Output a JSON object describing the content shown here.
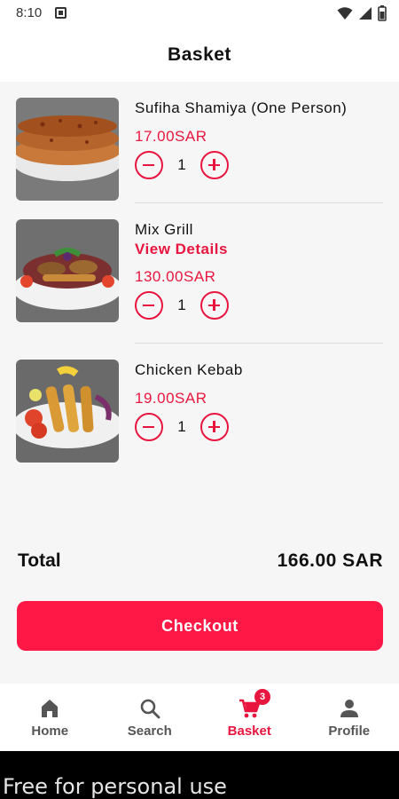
{
  "status_bar": {
    "time": "8:10"
  },
  "header": {
    "title": "Basket"
  },
  "items": [
    {
      "name": "Sufiha Shamiya (One Person)",
      "link": "",
      "price": "17.00SAR",
      "qty": "1"
    },
    {
      "name": "Mix Grill",
      "link": "View Details",
      "price": "130.00SAR",
      "qty": "1"
    },
    {
      "name": "Chicken Kebab",
      "link": "",
      "price": "19.00SAR",
      "qty": "1"
    }
  ],
  "summary": {
    "total_label": "Total",
    "total_value": "166.00 SAR"
  },
  "checkout": {
    "label": "Checkout"
  },
  "nav": {
    "items": [
      {
        "label": "Home",
        "icon": "home-icon"
      },
      {
        "label": "Search",
        "icon": "search-icon"
      },
      {
        "label": "Basket",
        "icon": "cart-icon",
        "badge": "3",
        "active": true
      },
      {
        "label": "Profile",
        "icon": "person-icon"
      }
    ]
  },
  "watermark": {
    "text": "Free for personal use"
  },
  "colors": {
    "accent": "#e8163f",
    "button": "#ff1845",
    "background": "#f6f6f6"
  }
}
